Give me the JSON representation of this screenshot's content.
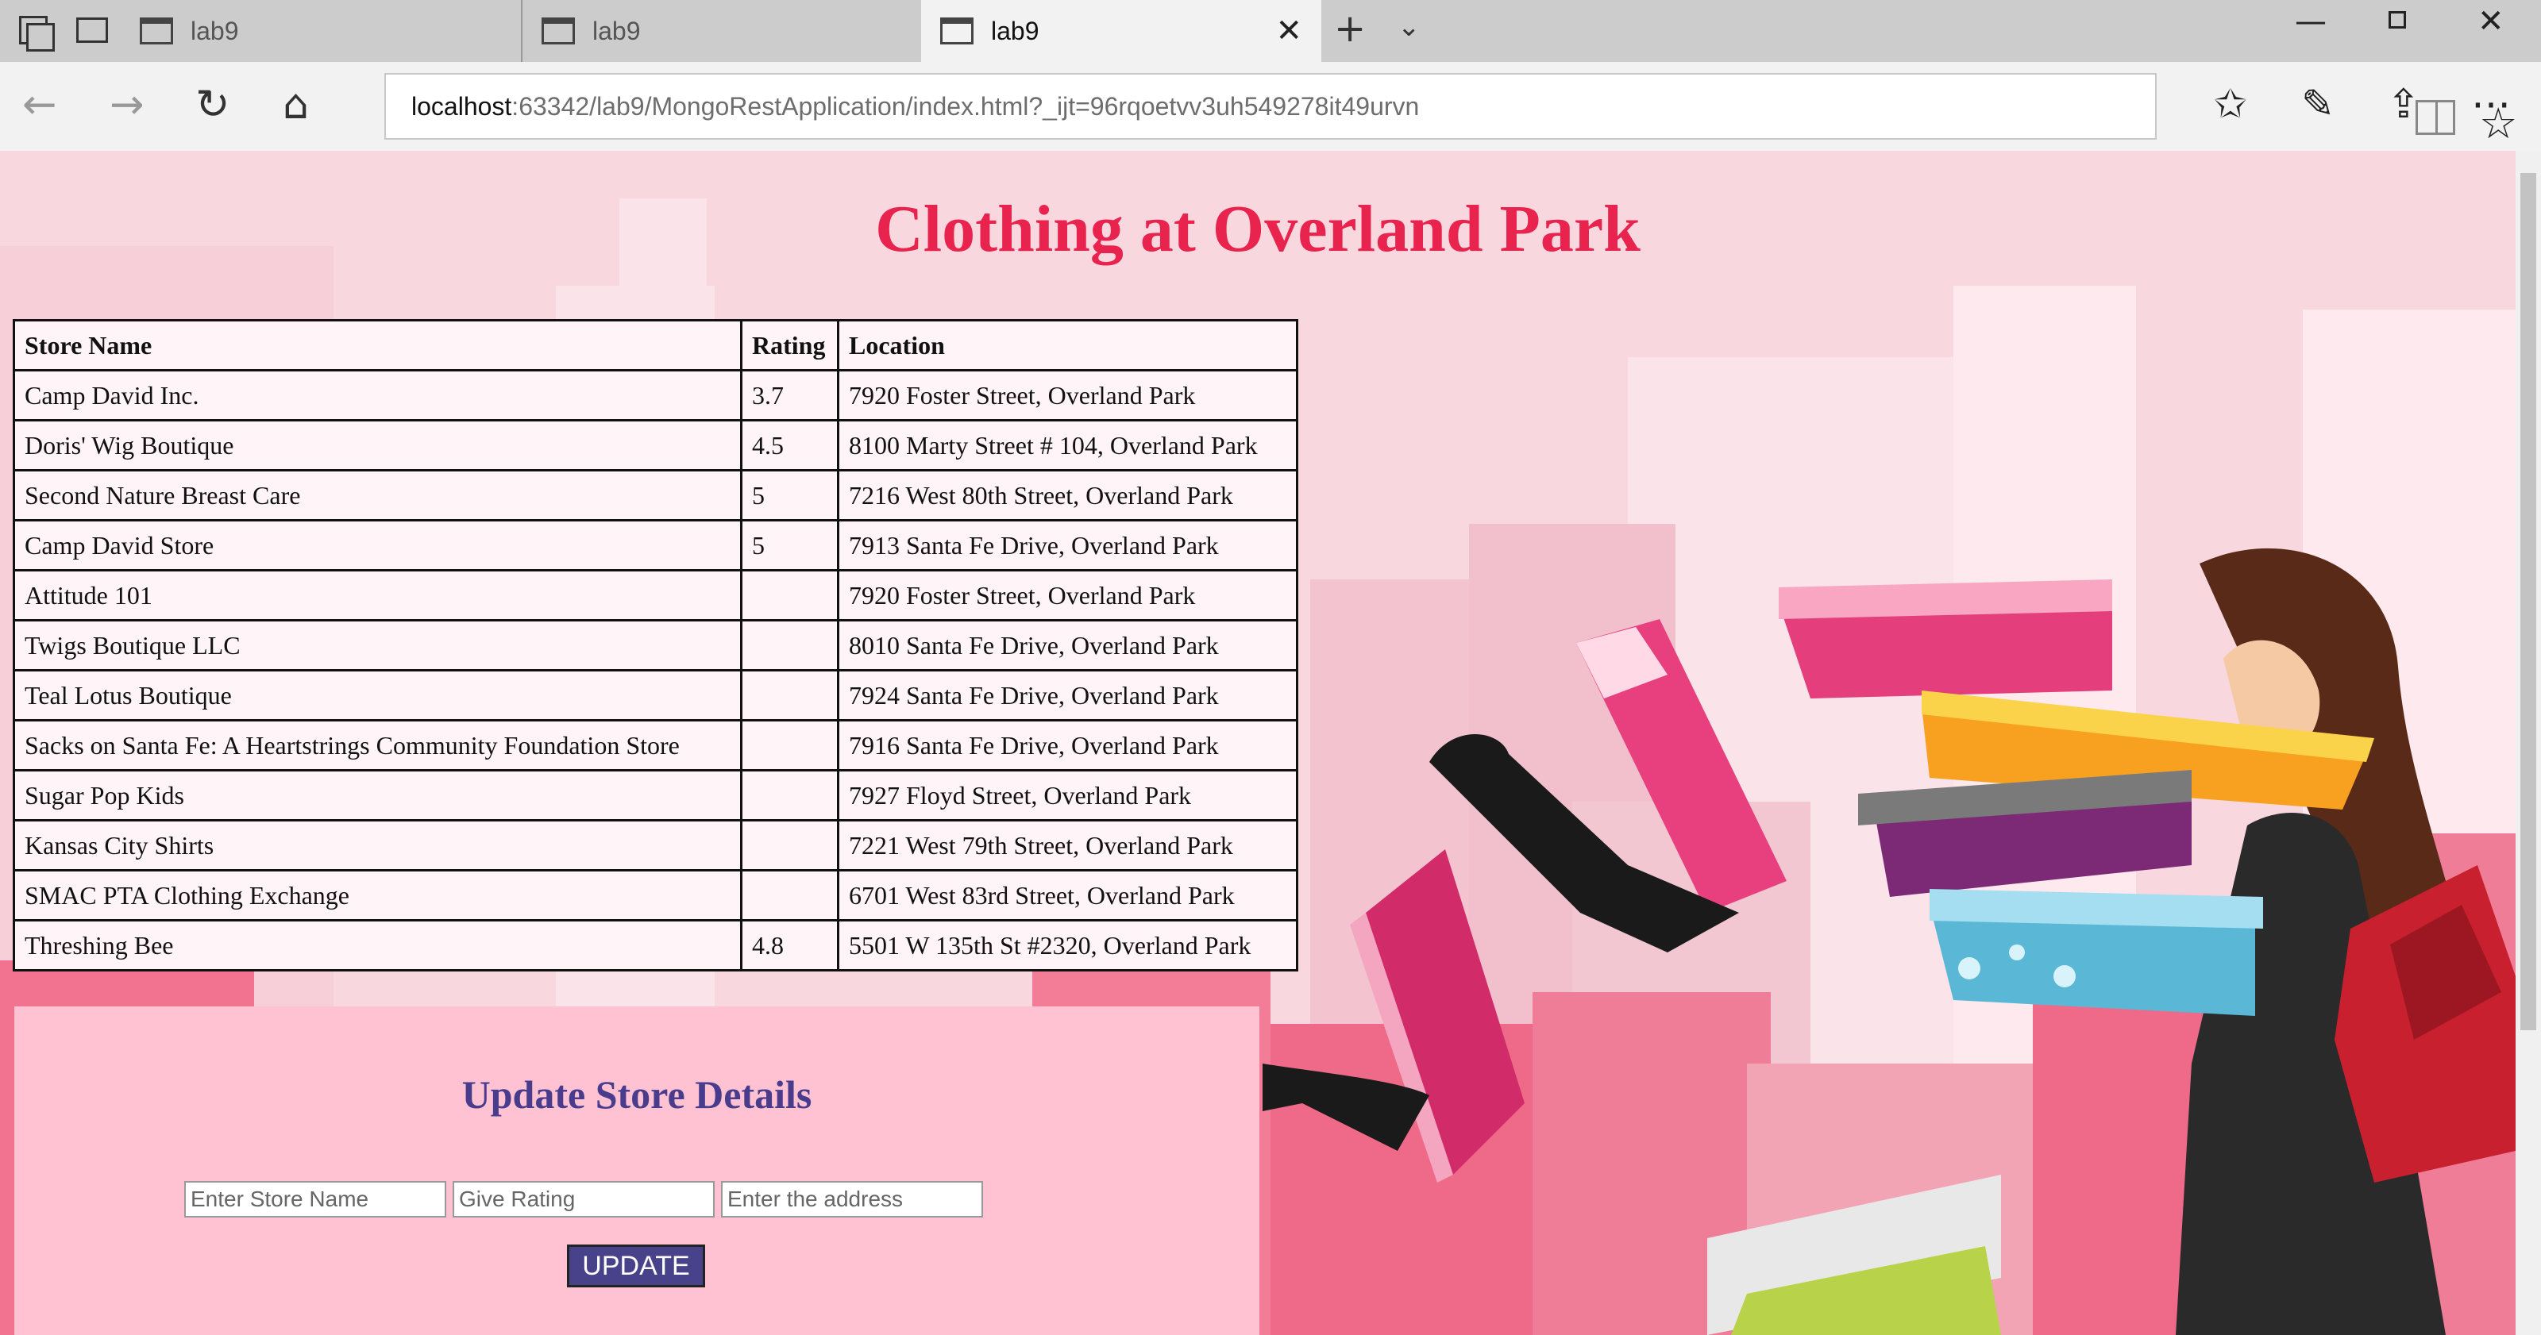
{
  "browser": {
    "tabs": [
      {
        "title": "lab9"
      },
      {
        "title": "lab9"
      },
      {
        "title": "lab9",
        "active": true
      }
    ],
    "address_host": "localhost",
    "address_rest": ":63342/lab9/MongoRestApplication/index.html?_ijt=96rqoetvv3uh549278it49urvn"
  },
  "page": {
    "title": "Clothing at Overland Park",
    "table": {
      "headers": [
        "Store Name",
        "Rating",
        "Location"
      ],
      "rows": [
        [
          "Camp David Inc.",
          "3.7",
          "7920 Foster Street, Overland Park"
        ],
        [
          "Doris' Wig Boutique",
          "4.5",
          "8100 Marty Street # 104, Overland Park"
        ],
        [
          "Second Nature Breast Care",
          "5",
          "7216 West 80th Street, Overland Park"
        ],
        [
          "Camp David Store",
          "5",
          "7913 Santa Fe Drive, Overland Park"
        ],
        [
          "Attitude 101",
          "",
          "7920 Foster Street, Overland Park"
        ],
        [
          "Twigs Boutique LLC",
          "",
          "8010 Santa Fe Drive, Overland Park"
        ],
        [
          "Teal Lotus Boutique",
          "",
          "7924 Santa Fe Drive, Overland Park"
        ],
        [
          "Sacks on Santa Fe: A Heartstrings Community Foundation Store",
          "",
          "7916 Santa Fe Drive, Overland Park"
        ],
        [
          "Sugar Pop Kids",
          "",
          "7927 Floyd Street, Overland Park"
        ],
        [
          "Kansas City Shirts",
          "",
          "7221 West 79th Street, Overland Park"
        ],
        [
          "SMAC PTA Clothing Exchange",
          "",
          "6701 West 83rd Street, Overland Park"
        ],
        [
          "Threshing Bee",
          "4.8",
          "5501 W 135th St #2320, Overland Park"
        ]
      ]
    },
    "update": {
      "title": "Update Store Details",
      "name_placeholder": "Enter Store Name",
      "rating_placeholder": "Give Rating",
      "address_placeholder": "Enter the address",
      "button_label": "UPDATE"
    }
  },
  "colors": {
    "title": "#e8234d",
    "update_title": "#4a3c8c",
    "panel": "#fec2d3",
    "button": "#47428a",
    "page_bg": "#f9d7df"
  }
}
